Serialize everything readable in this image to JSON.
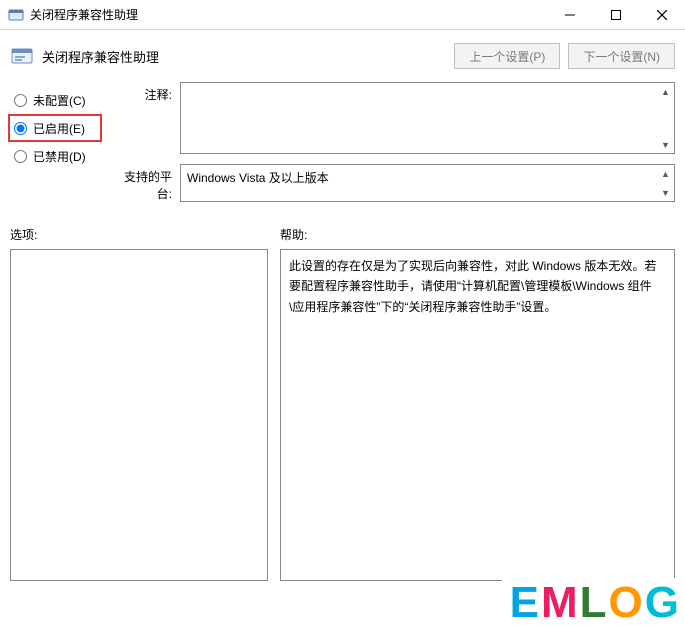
{
  "window": {
    "title": "关闭程序兼容性助理"
  },
  "header": {
    "title": "关闭程序兼容性助理",
    "prev_button": "上一个设置(P)",
    "next_button": "下一个设置(N)"
  },
  "radios": {
    "not_configured": "未配置(C)",
    "enabled": "已启用(E)",
    "disabled": "已禁用(D)",
    "selected": "enabled"
  },
  "fields": {
    "comment_label": "注释:",
    "comment_value": "",
    "platform_label": "支持的平台:",
    "platform_value": "Windows Vista 及以上版本"
  },
  "sections": {
    "options_label": "选项:",
    "help_label": "帮助:"
  },
  "help_text": "此设置的存在仅是为了实现后向兼容性，对此 Windows 版本无效。若要配置程序兼容性助手，请使用“计算机配置\\管理模板\\Windows 组件\\应用程序兼容性”下的“关闭程序兼容性助手”设置。",
  "watermark": {
    "text": "EMLOG"
  }
}
